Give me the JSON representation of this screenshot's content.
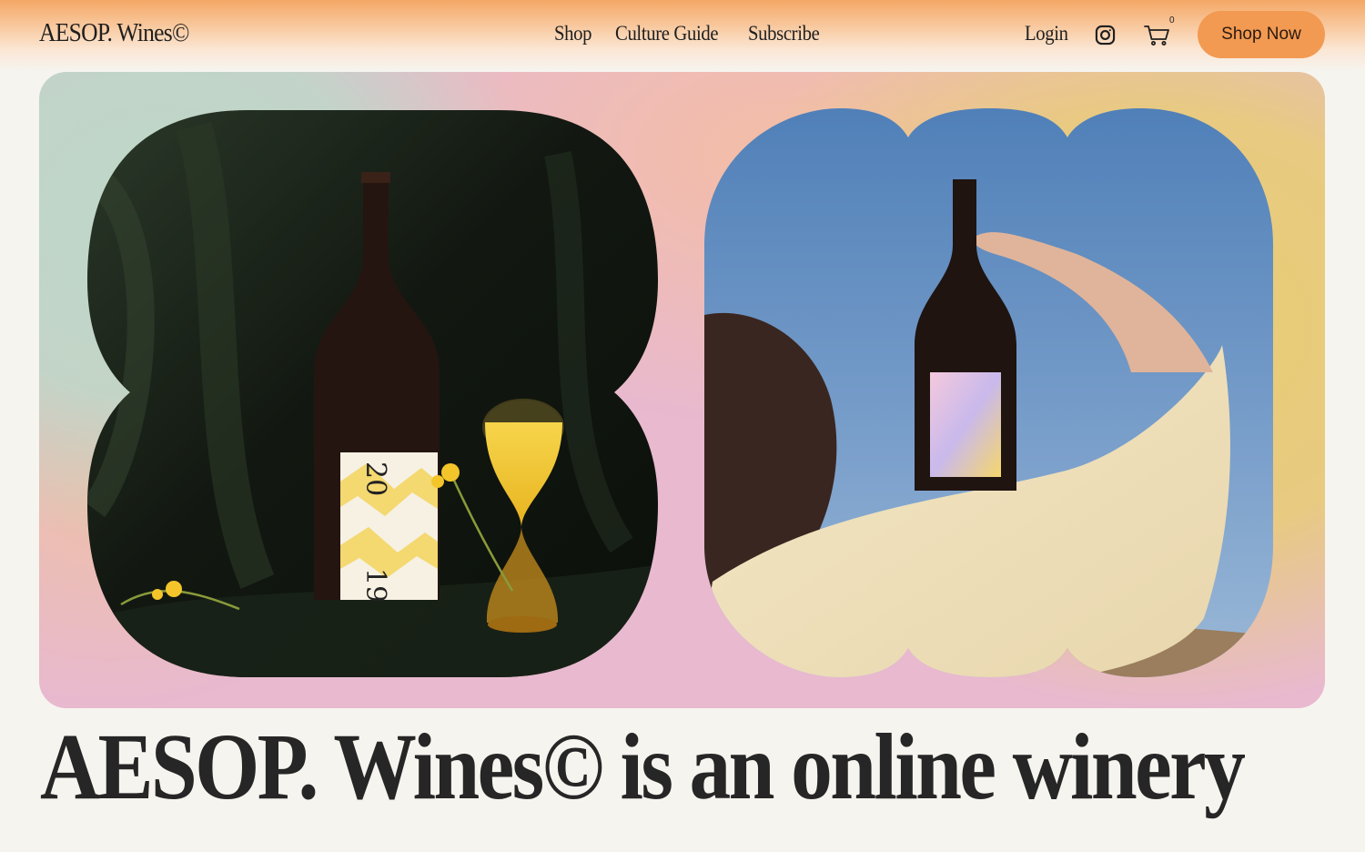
{
  "brand": {
    "logo": "AESOP. Wines©"
  },
  "nav": {
    "items": [
      {
        "label": "Shop"
      },
      {
        "label": "Culture Guide"
      },
      {
        "label": "Subscribe"
      }
    ]
  },
  "header_actions": {
    "login_label": "Login",
    "instagram_icon": "instagram-icon",
    "cart_icon": "cart-icon",
    "cart_count": "0",
    "cta_label": "Shop Now"
  },
  "hero": {
    "left_image": {
      "bottle_label_text_top": "20",
      "bottle_label_text_bottom": "19"
    }
  },
  "headline": "AESOP. Wines© is an online winery",
  "colors": {
    "accent": "#f29a52",
    "page_background": "#f6f4ef",
    "hero_pink": "#e8b9cf",
    "hero_green": "#bed7c8",
    "hero_yellow": "#e8cd73",
    "text": "#1e1e1e"
  }
}
